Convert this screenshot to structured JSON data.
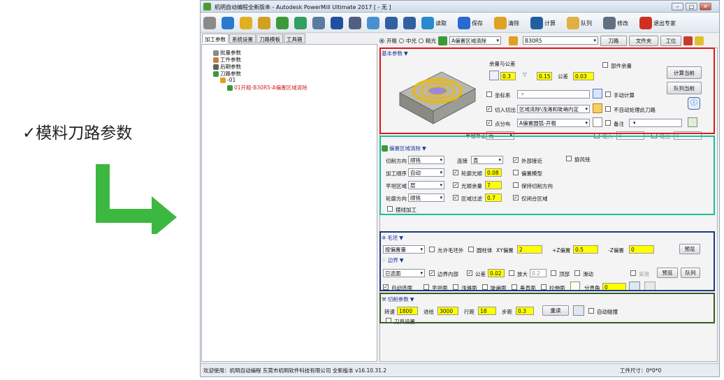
{
  "caption": "✓模料刀路参数",
  "colors": {
    "red": "#e01818",
    "teal": "#1cbc98",
    "navy": "#1a3a7a",
    "olive": "#3a5a24",
    "yellow": "#ffff00",
    "arrow": "#3cb840"
  },
  "window": {
    "title": "机明自动编程全新版本 - Autodesk PowerMill Ultimate 2017  [ - 无 ]",
    "controls": [
      "–",
      "□",
      "✕"
    ]
  },
  "toolbar": {
    "items": [
      {
        "icon": "gear-icon",
        "label": ""
      },
      {
        "icon": "globe-icon",
        "label": ""
      },
      {
        "icon": "folder-check-icon",
        "label": ""
      },
      {
        "icon": "folder-edit-icon",
        "label": ""
      },
      {
        "icon": "add-icon",
        "label": ""
      },
      {
        "icon": "matrix-icon",
        "label": ""
      },
      {
        "icon": "tool-icon",
        "label": ""
      },
      {
        "icon": "arrow-in-icon",
        "label": ""
      },
      {
        "icon": "path-icon",
        "label": ""
      },
      {
        "icon": "window-icon",
        "label": ""
      },
      {
        "icon": "first-icon",
        "label": ""
      },
      {
        "icon": "last-icon",
        "label": ""
      },
      {
        "icon": "read-icon",
        "label": "读取"
      },
      {
        "icon": "save-icon",
        "label": "保存"
      },
      {
        "icon": "clear-icon",
        "label": "清除"
      },
      {
        "icon": "calc-icon",
        "label": "计算"
      },
      {
        "icon": "queue-icon",
        "label": "队列"
      },
      {
        "icon": "edit-icon",
        "label": "修改"
      },
      {
        "icon": "exit-icon",
        "label": "退出专家"
      }
    ]
  },
  "left_tabs": [
    "加工参数",
    "系统设置",
    "刀路模板",
    "工具箱"
  ],
  "tree": [
    {
      "label": "批量参数",
      "indent": 1
    },
    {
      "label": "工件参数",
      "indent": 1
    },
    {
      "label": "后期参数",
      "indent": 1
    },
    {
      "label": "刀路参数",
      "indent": 1
    },
    {
      "label": "-01",
      "indent": 2
    },
    {
      "label": "01开粗-B30R5-A偏置区域清除",
      "indent": 3
    }
  ],
  "rtool": {
    "radios": [
      "开粗",
      "中光",
      "精光"
    ],
    "strategy": "A偏置区域清除",
    "tool": "B30R5",
    "buttons": [
      "刀路",
      "文件夹",
      "工位"
    ]
  },
  "basic": {
    "header": "基本参数",
    "allowance_label": "余量与公差",
    "allowance1": "0.3",
    "allowance2": "0.15",
    "tolerance_label": "公差",
    "tolerance": "0.03",
    "partial_allowance": "部件余量",
    "coord_label": "坐标系",
    "manual_calc": "手动计算",
    "cutin_label": "切入切出",
    "cutin_value": "区域清除\\浅滩和陡峭内定",
    "no_post": "不自动处理此刀路",
    "dist_label": "点分布",
    "dist_value": "A偏置圆弧-开粗",
    "remark_label": "备注",
    "calc_now": "计算当前",
    "queue_now": "队列当前",
    "half_label": "半径补正",
    "half_value": "无",
    "extra_a": "0",
    "extra_b": "0",
    "extra_a_label": "吸入",
    "extra_b_label": "吸出"
  },
  "offset": {
    "header": "偏置区域清除",
    "rows": [
      {
        "label": "切削方向",
        "value": "顺铣"
      },
      {
        "label": "加工顺序",
        "value": "自动"
      },
      {
        "label": "平坦区域",
        "value": "层"
      },
      {
        "label": "轮廓方向",
        "value": "顺铣"
      }
    ],
    "connect_label": "连接",
    "connect_value": "直",
    "outer_first": "外部接近",
    "spiral": "旋风铣",
    "smooth_label": "轮廓光顺",
    "smooth": "0.08",
    "offset_model": "偏置模型",
    "allow_label": "光顺余量",
    "allow": "7",
    "keep_dir": "保持切削方向",
    "filter_label": "区域过滤",
    "filter": "0.7",
    "closed_only": "仅闭合区域",
    "trochoid": "摆线加工"
  },
  "blank": {
    "header": "毛坯",
    "mode": "按偏置量",
    "allow_outside": "允许毛坯外",
    "cylinder": "圆柱体",
    "xy_label": "XY偏置",
    "xy": "2",
    "z_label": "+Z偏置",
    "z": "0.5",
    "zneg_label": "-Z偏置",
    "zneg": "0",
    "preview": "预览"
  },
  "boundary": {
    "header": "边界",
    "mode": "已选面",
    "inner": "边界内部",
    "tol_label": "公差",
    "tol": "0.02",
    "enlarge_label": "放大",
    "enlarge": "0.2",
    "top": "顶部",
    "sliding": "滑动",
    "adopt": "采用",
    "preview": "预览",
    "queue": "队列",
    "auto_select": "自动选面",
    "flat": "平坦面",
    "shallow": "浅滩面",
    "steep": "陡峭面",
    "vertical": "垂直面",
    "draft": "拉伸面",
    "split_label": "分界角",
    "split": "0"
  },
  "cutting": {
    "header": "切削参数",
    "speed_label": "转速",
    "speed": "1800",
    "feed_label": "进给",
    "feed": "3000",
    "row_label": "行距",
    "row": "18",
    "step_label": "步距",
    "step": "0.3",
    "reset": "重读",
    "auto_collision": "自动碰撞",
    "tool_setting": "刀具设置"
  },
  "status": {
    "left": "欢迎使用：机明自动编程 东莞市机明软件科技有限公司 全新版本 v16.10.31.2",
    "right": "工件尺寸：0*0*0"
  }
}
